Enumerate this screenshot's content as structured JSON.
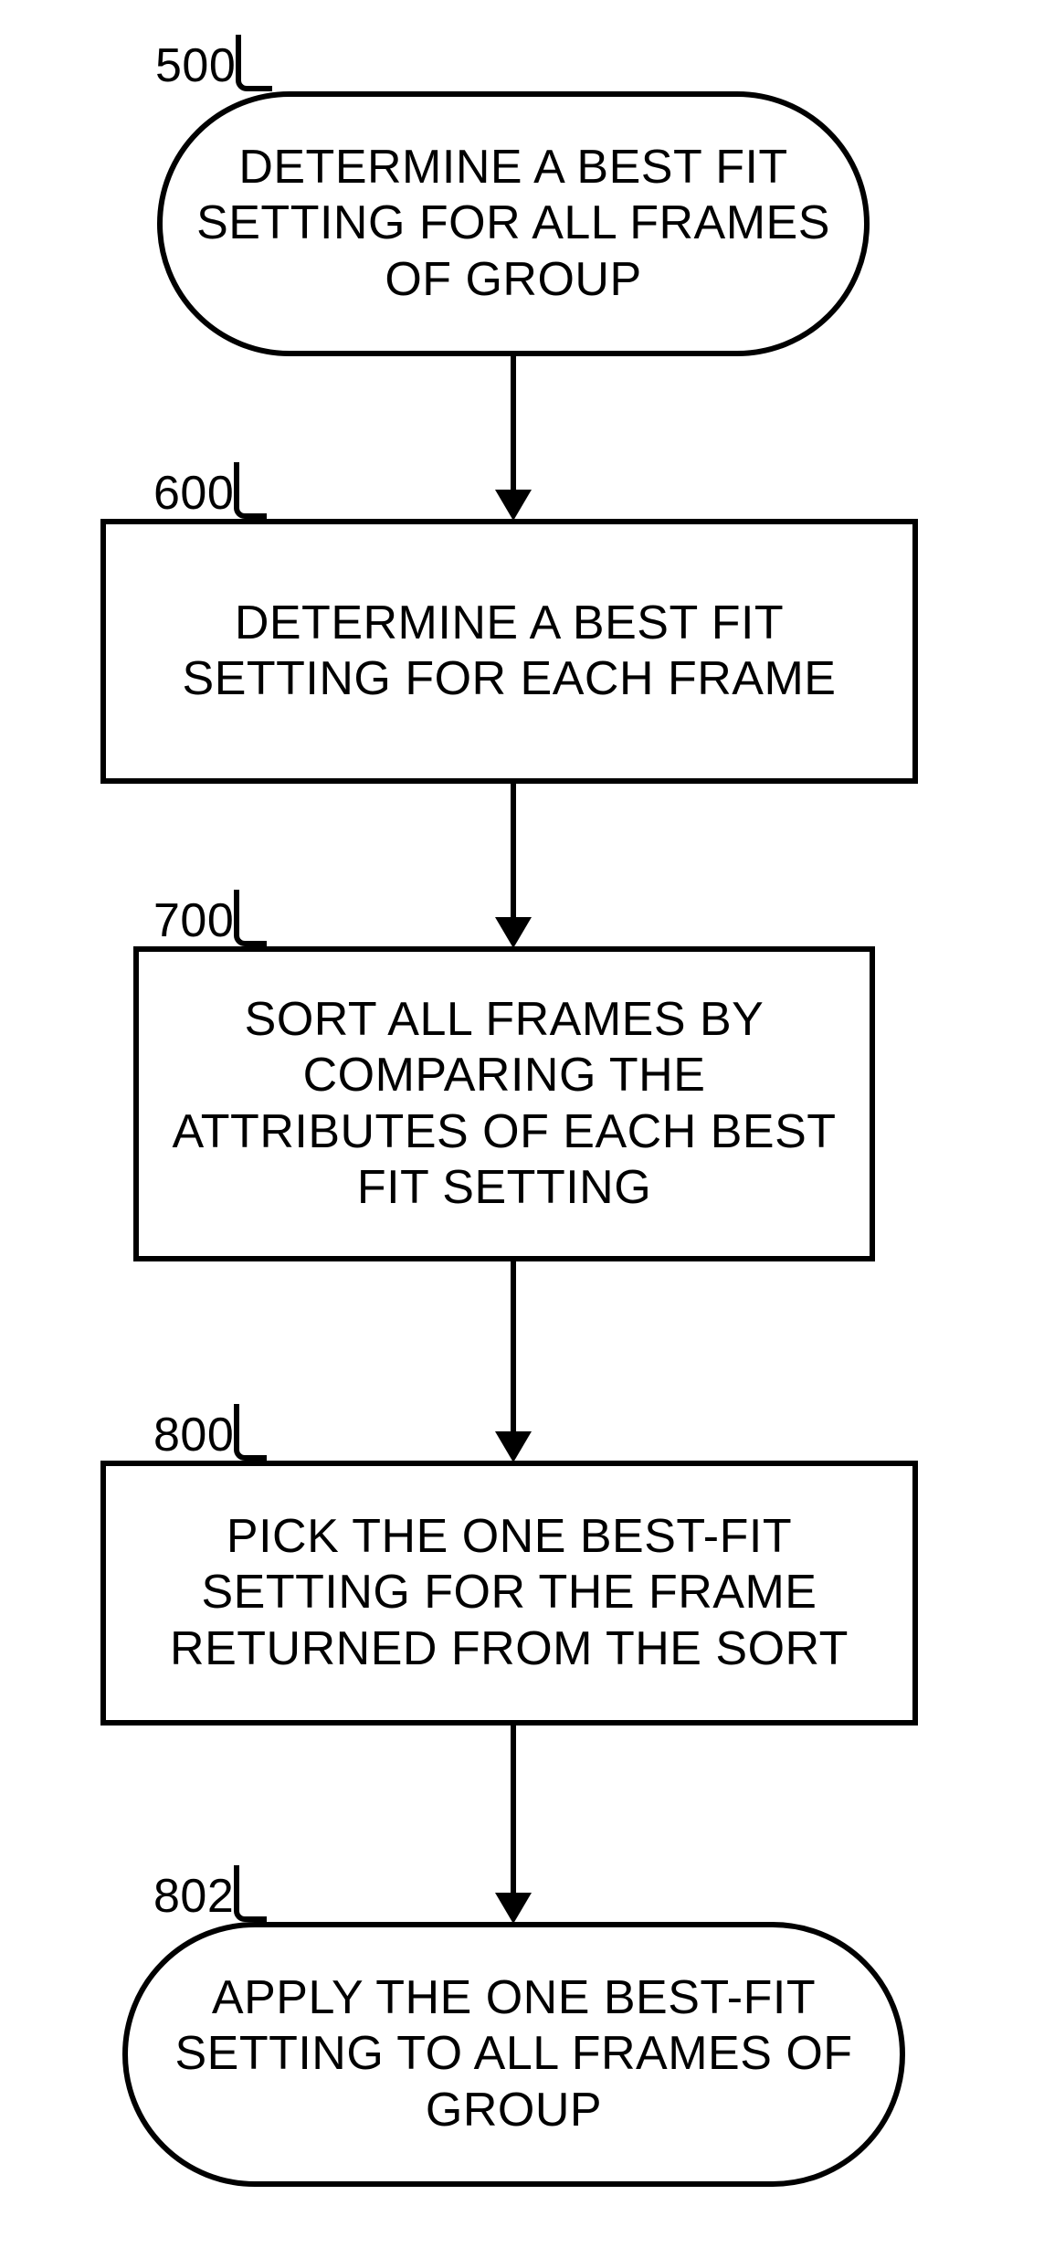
{
  "nodes": {
    "n500": {
      "id": "500",
      "text": "DETERMINE A BEST FIT SETTING FOR ALL FRAMES OF GROUP"
    },
    "n600": {
      "id": "600",
      "text": "DETERMINE A BEST FIT SETTING FOR EACH FRAME"
    },
    "n700": {
      "id": "700",
      "text": "SORT ALL FRAMES BY COMPARING THE ATTRIBUTES OF EACH BEST FIT SETTING"
    },
    "n800": {
      "id": "800",
      "text": "PICK THE ONE BEST-FIT SETTING FOR THE FRAME RETURNED FROM THE SORT"
    },
    "n802": {
      "id": "802",
      "text": "APPLY THE ONE BEST-FIT SETTING TO ALL FRAMES OF GROUP"
    }
  }
}
